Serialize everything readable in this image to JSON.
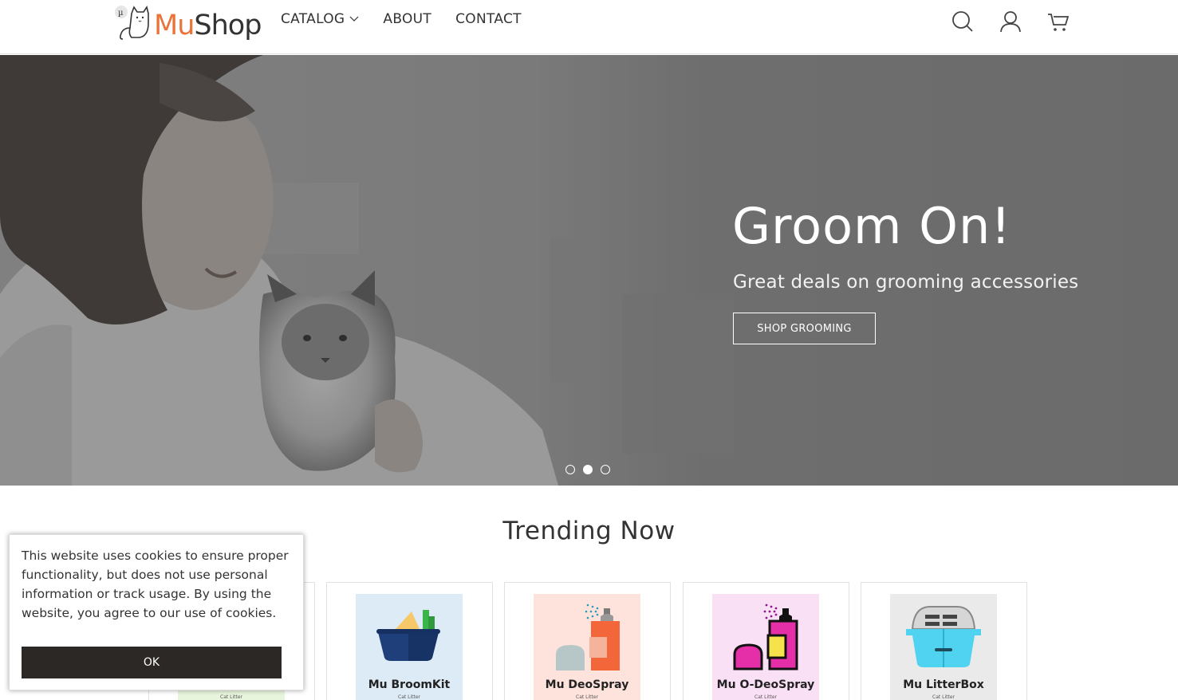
{
  "header": {
    "logo": {
      "mark": "µ",
      "text_mu": "Mu",
      "text_shop": "Shop"
    },
    "nav": [
      {
        "label": "CATALOG",
        "has_dropdown": true
      },
      {
        "label": "ABOUT",
        "has_dropdown": false
      },
      {
        "label": "CONTACT",
        "has_dropdown": false
      }
    ],
    "icons": [
      "search-icon",
      "user-icon",
      "cart-icon"
    ]
  },
  "hero": {
    "title": "Groom On!",
    "subtitle": "Great deals on grooming accessories",
    "button_label": "SHOP GROOMING",
    "slides": 3,
    "active_slide": 2
  },
  "trending": {
    "title": "Trending Now",
    "products": [
      {
        "name": "",
        "category": "Cat Litter",
        "bg": "#e8f5dd"
      },
      {
        "name": "Mu BroomKit",
        "category": "Cat Litter",
        "bg": "#dcebf6"
      },
      {
        "name": "Mu DeoSpray",
        "category": "Cat Litter",
        "bg": "#fde3dc"
      },
      {
        "name": "Mu O-DeoSpray",
        "category": "Cat Litter",
        "bg": "#fae0f5"
      },
      {
        "name": "Mu LitterBox",
        "category": "Cat Litter",
        "bg": "#eaeaea"
      }
    ]
  },
  "cookie": {
    "text": "This website uses cookies to ensure proper functionality, but does not use personal information or track usage. By using the website, you agree to our use of cookies.",
    "button_label": "OK"
  },
  "colors": {
    "brand_orange": "#e8743b",
    "dark": "#2b2826",
    "hero_overlay": "#6b6b6b"
  }
}
